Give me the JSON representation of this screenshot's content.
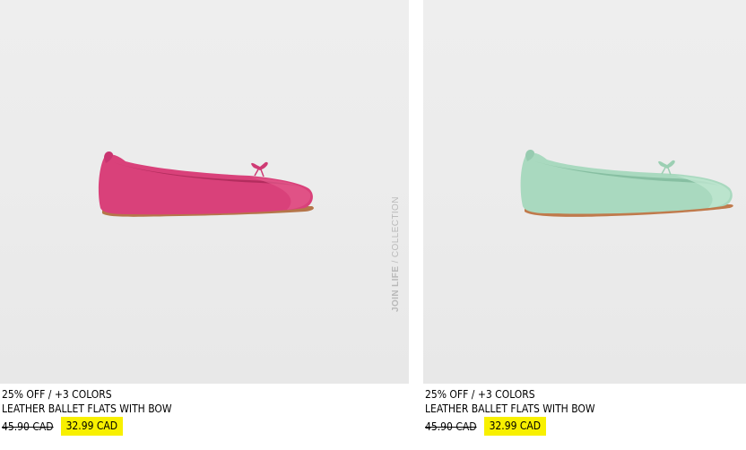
{
  "products": [
    {
      "promo": "25% OFF / +3 COLORS",
      "name": "LEATHER BALLET FLATS WITH BOW",
      "old_price": "45.90 CAD",
      "new_price": "32.99 CAD",
      "shoe_color": "#d9417a",
      "side_tag": {
        "bold": "JOIN LIFE",
        "rest": " / COLLECTION"
      }
    },
    {
      "promo": "25% OFF / +3 COLORS",
      "name": "LEATHER BALLET FLATS WITH BOW",
      "old_price": "45.90 CAD",
      "new_price": "32.99 CAD",
      "shoe_color": "#a9d9bf"
    }
  ],
  "colors": {
    "price_highlight": "#f8f000",
    "image_bg": "#ececec"
  }
}
